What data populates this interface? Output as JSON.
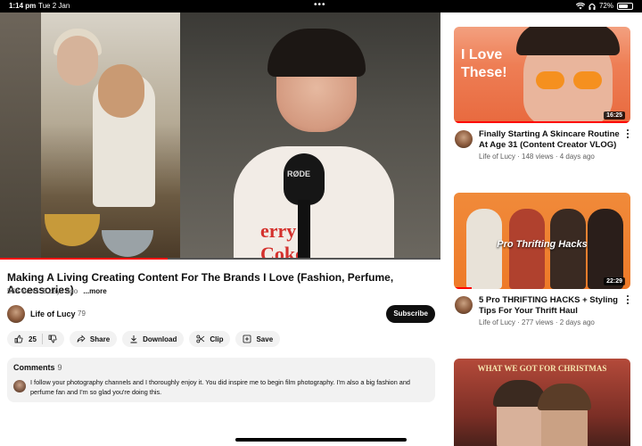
{
  "status_bar": {
    "time": "1:14 pm",
    "date": "Tue 2 Jan",
    "battery": "72%",
    "battery_level": 0.72
  },
  "player": {
    "progress_fraction": 0.38
  },
  "video": {
    "title": "Making A Living Creating Content For The Brands I Love (Fashion, Perfume, Accessories)",
    "views": "588 views",
    "age": "8 days ago",
    "more_label": "...more"
  },
  "channel": {
    "name": "Life of Lucy",
    "subscriber_count": "79",
    "subscribe_label": "Subscribe"
  },
  "actions": {
    "like_count": "25",
    "share_label": "Share",
    "download_label": "Download",
    "clip_label": "Clip",
    "save_label": "Save"
  },
  "comments": {
    "label": "Comments",
    "count": "9",
    "top_comment": "I follow your photography channels and I thoroughly enjoy it. You did inspire me to begin film photography. I'm also a big fashion and perfume fan and I'm so glad you're doing this."
  },
  "recommendations": [
    {
      "thumb_text_line1": "I Love",
      "thumb_text_line2": "These!",
      "duration": "16:25",
      "title": "Finally Starting A Skincare Routine At Age 31 (Content Creator VLOG)",
      "channel": "Life of Lucy",
      "views": "148 views",
      "age": "4 days ago",
      "progress_fraction": 1.0
    },
    {
      "thumb_text": "Pro Thrifting Hacks",
      "duration": "22:29",
      "title": "5 Pro THRIFTING HACKS + Styling Tips For Your Thrift Haul",
      "channel": "Life of Lucy",
      "views": "277 views",
      "age": "2 days ago",
      "progress_fraction": 0.1
    },
    {
      "thumb_text": "WHAT WE GOT FOR CHRISTMAS"
    }
  ],
  "colors": {
    "accent_red": "#ff0000",
    "subscribe_bg": "#0f0f0f",
    "pill_bg": "#f2f2f2"
  }
}
